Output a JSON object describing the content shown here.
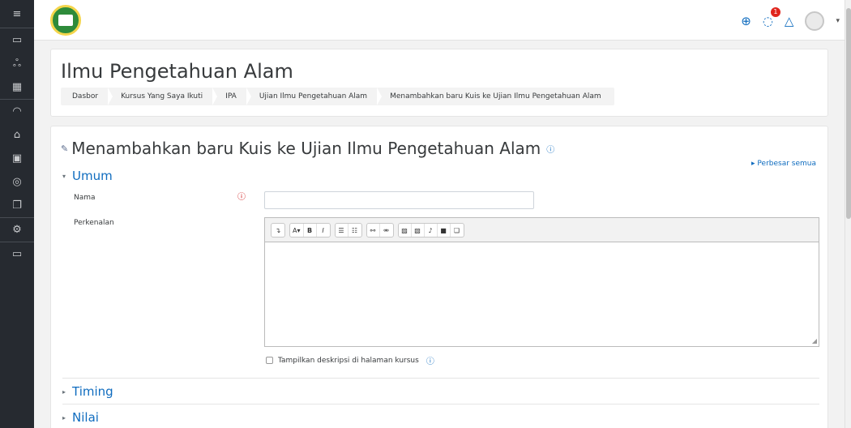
{
  "nav": {
    "items": [
      {
        "icon": "folder-icon",
        "glyph": "▭"
      },
      {
        "icon": "users-icon",
        "glyph": "ஃ"
      },
      {
        "icon": "grades-icon",
        "glyph": "▦"
      },
      {
        "icon": "dashboard-icon",
        "glyph": "◠"
      },
      {
        "icon": "home-icon",
        "glyph": "⌂"
      },
      {
        "icon": "calendar-icon",
        "glyph": "▣"
      },
      {
        "icon": "graduation-cap-icon",
        "glyph": "◎"
      },
      {
        "icon": "files-icon",
        "glyph": "❐"
      },
      {
        "icon": "gear-icon",
        "glyph": "⚙"
      },
      {
        "icon": "folder-icon",
        "glyph": "▭"
      }
    ]
  },
  "topbar": {
    "icons": {
      "language": "⊕",
      "messages": "◌",
      "notifications": "△"
    },
    "message_badge": "1",
    "user_menu_caret": "▾"
  },
  "header": {
    "title": "Ilmu Pengetahuan Alam",
    "breadcrumbs": [
      "Dasbor",
      "Kursus Yang Saya Ikuti",
      "IPA",
      "Ujian Ilmu Pengetahuan Alam",
      "Menambahkan baru Kuis ke Ujian Ilmu Pengetahuan Alam"
    ]
  },
  "form": {
    "title": "Menambahkan baru Kuis ke Ujian Ilmu Pengetahuan Alam",
    "expand_all": "Perbesar semua",
    "sections": {
      "general": "Umum",
      "timing": "Timing",
      "grade": "Nilai"
    },
    "name_label": "Nama",
    "name_value": "",
    "intro_label": "Perkenalan",
    "show_description_label": "Tampilkan deskripsi di halaman kursus",
    "toolbar": {
      "groups": [
        [
          "↴"
        ],
        [
          "A▾",
          "B",
          "I"
        ],
        [
          "☰",
          "☷"
        ],
        [
          "⚯",
          "⚮"
        ],
        [
          "▨",
          "▧",
          "♪",
          "■",
          "❏"
        ]
      ]
    }
  },
  "colors": {
    "link": "#0f6cbf",
    "nav_bg": "#262a30",
    "required": "#c90000",
    "badge": "#e0251d"
  }
}
